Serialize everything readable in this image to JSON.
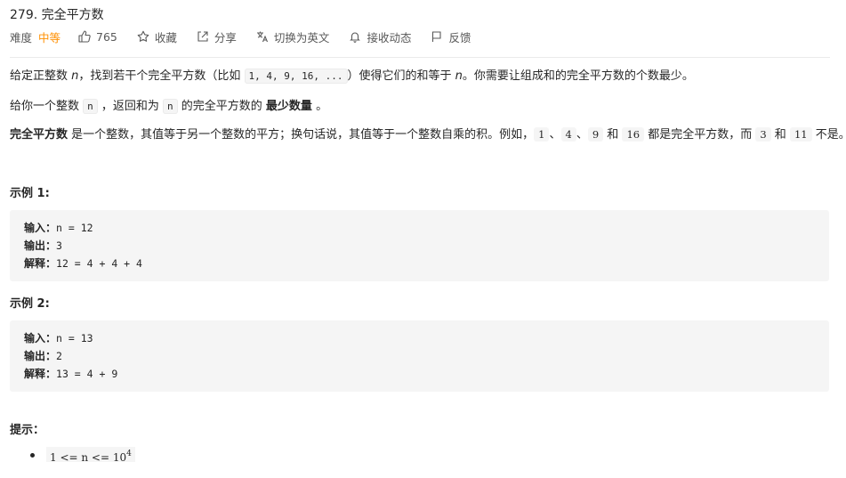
{
  "header": {
    "title": "279. 完全平方数",
    "difficulty_label": "难度",
    "difficulty": "中等",
    "likes": "765",
    "favorite": "收藏",
    "share": "分享",
    "switch_lang": "切换为英文",
    "follow": "接收动态",
    "feedback": "反馈",
    "accent_color": "#ff8f00"
  },
  "description": {
    "p1_a": "给定正整数 ",
    "p1_n": "n",
    "p1_b": "，找到若干个完全平方数（比如 ",
    "p1_code": "1, 4, 9, 16, ...",
    "p1_c": "）使得它们的和等于 ",
    "p1_n2": "n",
    "p1_d": "。你需要让组成和的完全平方数的个数最少。",
    "p2_a": "给你一个整数 ",
    "p2_code1": "n",
    "p2_b": " ，返回和为 ",
    "p2_code2": "n",
    "p2_c": " 的完全平方数的 ",
    "p2_bold": "最少数量",
    "p2_d": " 。",
    "p3_bold": "完全平方数",
    "p3_a": " 是一个整数，其值等于另一个整数的平方；换句话说，其值等于一个整数自乘的积。例如，",
    "p3_c1": "1",
    "p3_sep1": "、",
    "p3_c2": "4",
    "p3_sep2": "、",
    "p3_c3": "9",
    "p3_and1": " 和 ",
    "p3_c4": "16",
    "p3_b": " 都是完全平方数，而 ",
    "p3_c5": "3",
    "p3_and2": " 和 ",
    "p3_c6": "11",
    "p3_end": " 不是。"
  },
  "examples": [
    {
      "heading": "示例 1:",
      "input_label": "输入：",
      "input": "n = 12",
      "output_label": "输出：",
      "output": "3",
      "explain_label": "解释：",
      "explain": "12 = 4 + 4 + 4"
    },
    {
      "heading": "示例 2:",
      "input_label": "输入：",
      "input": "n = 13",
      "output_label": "输出：",
      "output": "2",
      "explain_label": "解释：",
      "explain": "13 = 4 + 9"
    }
  ],
  "hints": {
    "heading": "提示：",
    "constraint_text": "1 <= n <= 10",
    "constraint_exp": "4"
  }
}
